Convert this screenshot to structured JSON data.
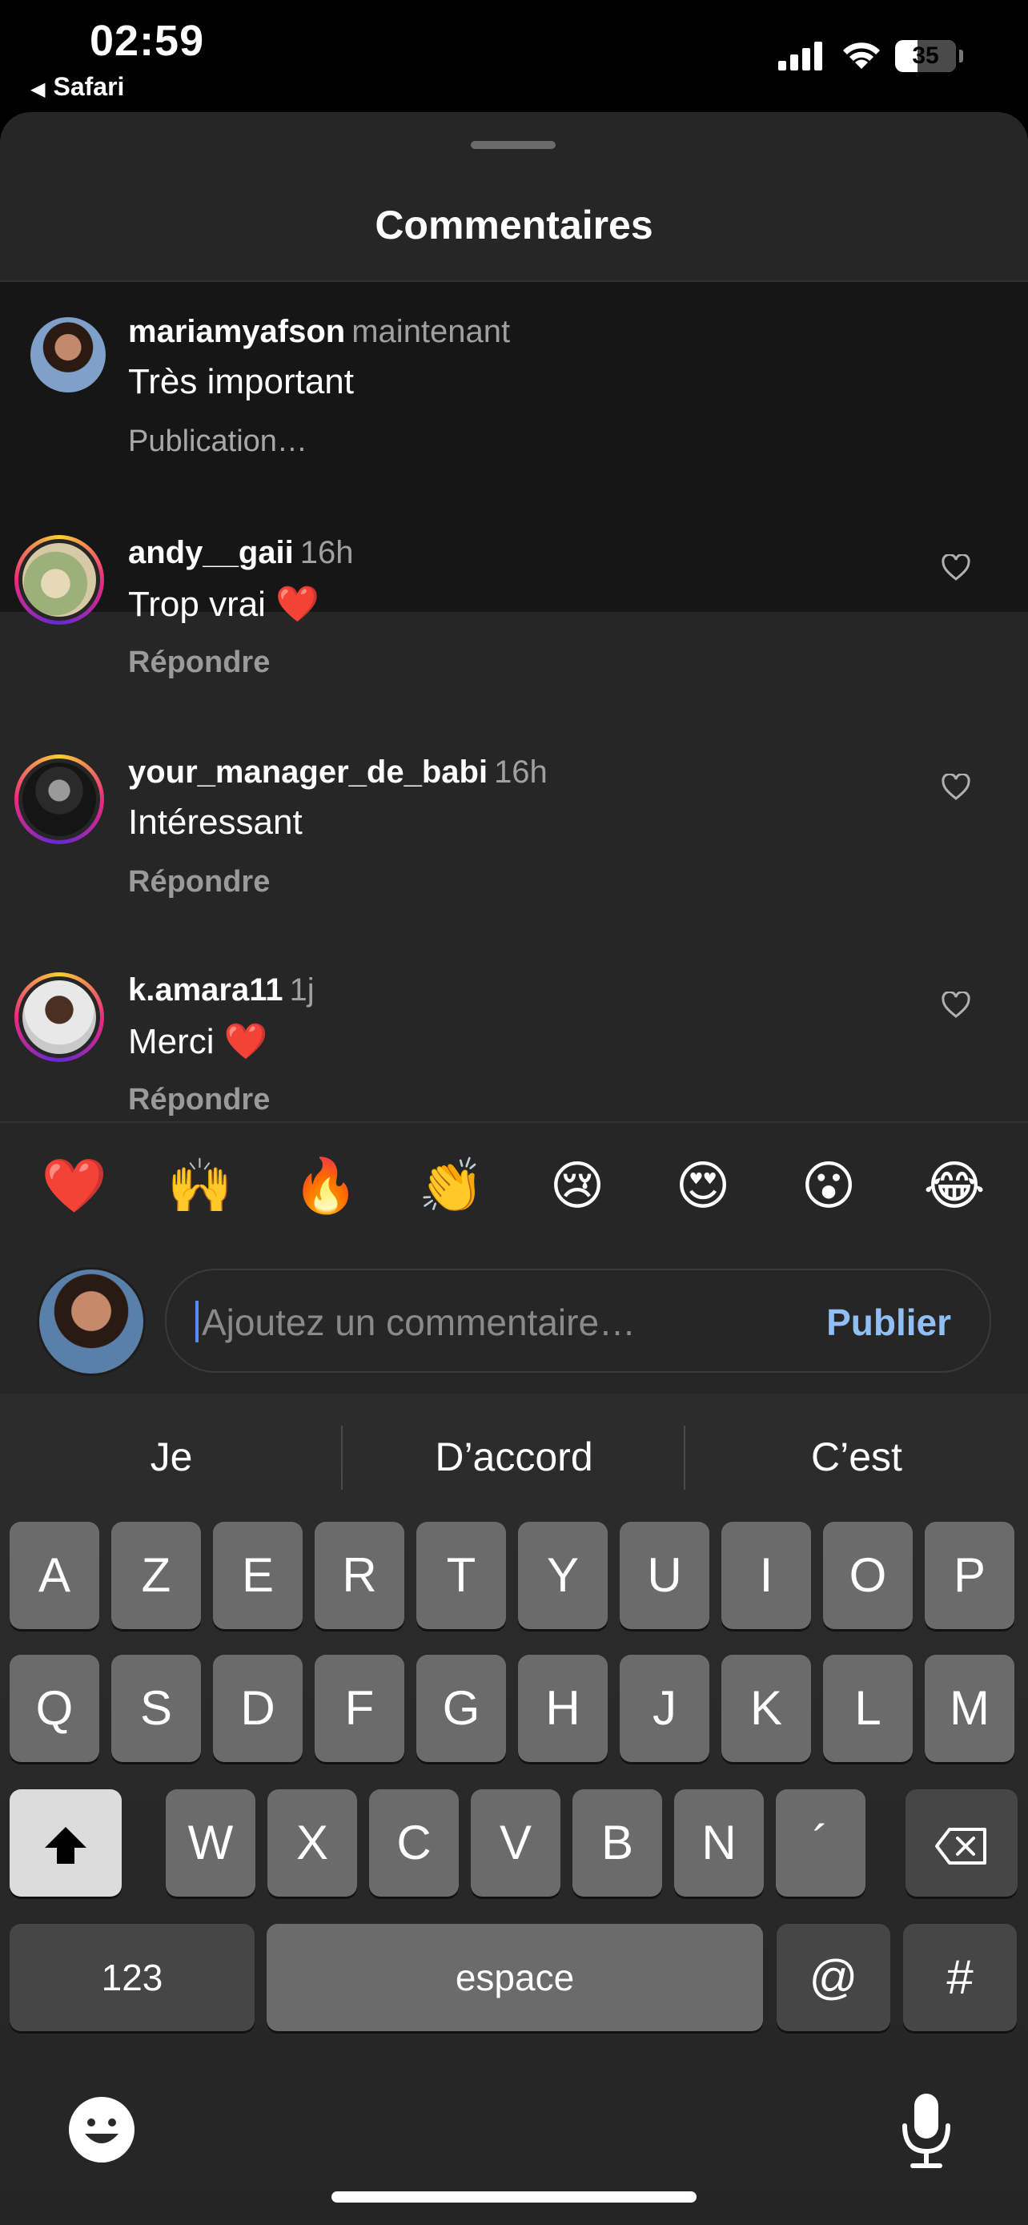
{
  "status_bar": {
    "time": "02:59",
    "back_label": "Safari",
    "battery": "35"
  },
  "sheet": {
    "title": "Commentaires"
  },
  "comments": [
    {
      "user": "mariamyafson",
      "time": "maintenant",
      "text": "Très important",
      "sub": "Publication…"
    },
    {
      "user": "andy__gaii",
      "time": "16h",
      "text": "Trop vrai ❤️",
      "sub": "Répondre"
    },
    {
      "user": "your_manager_de_babi",
      "time": "16h",
      "text": "Intéressant",
      "sub": "Répondre"
    },
    {
      "user": "k.amara11",
      "time": "1j",
      "text": "Merci ❤️",
      "sub": "Répondre"
    }
  ],
  "emoji_bar": [
    "❤️",
    "🙌",
    "🔥",
    "👏",
    "😢",
    "😍",
    "😮",
    "😂"
  ],
  "composer": {
    "placeholder": "Ajoutez un commentaire…",
    "publish_label": "Publier"
  },
  "keyboard": {
    "suggestions": [
      "Je",
      "D’accord",
      "C’est"
    ],
    "row1": [
      "A",
      "Z",
      "E",
      "R",
      "T",
      "Y",
      "U",
      "I",
      "O",
      "P"
    ],
    "row2": [
      "Q",
      "S",
      "D",
      "F",
      "G",
      "H",
      "J",
      "K",
      "L",
      "M"
    ],
    "row3": [
      "W",
      "X",
      "C",
      "V",
      "B",
      "N",
      "´"
    ],
    "numbers_label": "123",
    "space_label": "espace",
    "at_label": "@",
    "hash_label": "#"
  },
  "colors": {
    "sheet_bg": "#262626",
    "highlight_bg": "#161616",
    "publish": "#8fbff5",
    "key": "#6b6b6b"
  }
}
